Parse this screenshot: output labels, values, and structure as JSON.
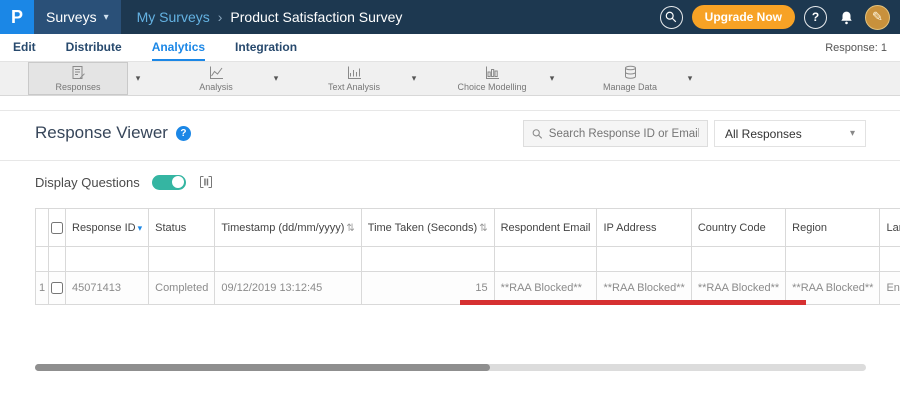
{
  "icons": {
    "caret_down": "▾",
    "sort_both": "⇅",
    "question_mark": "?",
    "breadcrumb_separator": "›",
    "pencil": "✎"
  },
  "colors": {
    "topbar_bg": "#1d3850",
    "accent_blue": "#1b87e6",
    "upgrade_orange": "#f7a225",
    "toggle_teal": "#35b5a2",
    "annotation_red": "#d63031"
  },
  "topbar": {
    "logo_letter": "P",
    "product_switcher_label": "Surveys",
    "breadcrumb_parent": "My Surveys",
    "breadcrumb_current": "Product Satisfaction Survey",
    "upgrade_label": "Upgrade Now"
  },
  "nav": {
    "tabs": [
      {
        "label": "Edit"
      },
      {
        "label": "Distribute"
      },
      {
        "label": "Analytics"
      },
      {
        "label": "Integration"
      }
    ],
    "active_tab": "Analytics",
    "response_count": "Response: 1"
  },
  "toolbar": {
    "selected": "Responses",
    "items": [
      {
        "label": "Responses"
      },
      {
        "label": "Analysis"
      },
      {
        "label": "Text Analysis"
      },
      {
        "label": "Choice Modelling"
      },
      {
        "label": "Manage Data"
      }
    ]
  },
  "viewer": {
    "title": "Response Viewer",
    "search_placeholder": "Search Response ID or Email",
    "filter_value": "All Responses",
    "display_questions_label": "Display Questions",
    "display_questions_on": true
  },
  "table": {
    "headers": [
      "Response ID",
      "Status",
      "Timestamp (dd/mm/yyyy)",
      "Time Taken (Seconds)",
      "Respondent Email",
      "IP Address",
      "Country Code",
      "Region",
      "Language"
    ],
    "rows": [
      {
        "row_number": "1",
        "response_id": "45071413",
        "status": "Completed",
        "timestamp": "09/12/2019 13:12:45",
        "time_taken_seconds": "15",
        "respondent_email": "**RAA Blocked**",
        "ip_address": "**RAA Blocked**",
        "country_code": "**RAA Blocked**",
        "region": "**RAA Blocked**",
        "language": "English"
      }
    ]
  }
}
